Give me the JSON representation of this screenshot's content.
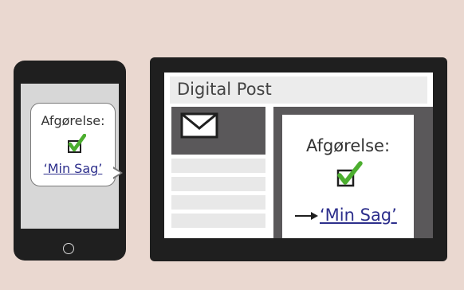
{
  "phone": {
    "bubble_title": "Afgørelse:",
    "bubble_link": "‘Min Sag’"
  },
  "tablet": {
    "header_title": "Digital Post",
    "card_title": "Afgørelse:",
    "card_link": "‘Min Sag’"
  },
  "icons": {
    "envelope": "envelope-icon",
    "checkbox_checked": "checked-box-icon",
    "arrow": "arrow-right-icon",
    "home_button": "home-button"
  },
  "colors": {
    "background": "#ead8d0",
    "device": "#1f1f1f",
    "check_green": "#4cae2f",
    "link": "#2d2f8c",
    "panel_dark": "#5a585a"
  }
}
